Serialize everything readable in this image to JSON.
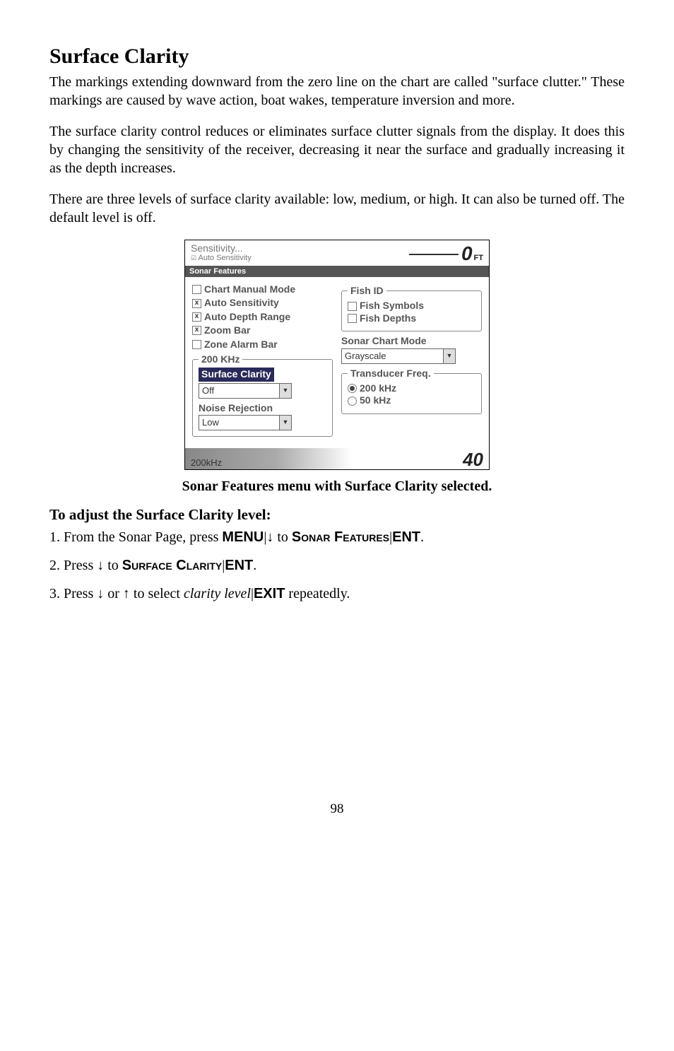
{
  "heading": "Surface Clarity",
  "para1": "The markings extending downward from the zero line on the chart are called \"surface clutter.\" These markings are caused by wave action, boat wakes, temperature inversion and more.",
  "para2": "The surface clarity control reduces or eliminates surface clutter signals from the display. It does this by changing the sensitivity of the receiver, decreasing it near the surface and gradually increasing it as the depth increases.",
  "para3": "There are three levels of surface clarity available: low, medium, or high. It can also be turned off. The default level is off.",
  "figure": {
    "top": {
      "sensitivity_label": "Sensitivity...",
      "auto_sens_partial": "Auto Sensitivity",
      "depth_value": "0",
      "depth_unit": "FT"
    },
    "tab_title": "Sonar Features",
    "left_col": {
      "chart_manual_mode": {
        "label": "Chart Manual Mode",
        "checked": false
      },
      "auto_sensitivity": {
        "label": "Auto Sensitivity",
        "checked": true
      },
      "auto_depth_range": {
        "label": "Auto Depth Range",
        "checked": true
      },
      "zoom_bar": {
        "label": "Zoom Bar",
        "checked": true
      },
      "zone_alarm_bar": {
        "label": "Zone Alarm Bar",
        "checked": false
      },
      "freq_group_label": "200 KHz",
      "surface_clarity_label": "Surface Clarity",
      "surface_clarity_value": "Off",
      "noise_rejection_label": "Noise Rejection",
      "noise_rejection_value": "Low"
    },
    "right_col": {
      "fish_id_label": "Fish ID",
      "fish_symbols": {
        "label": "Fish Symbols",
        "checked": false
      },
      "fish_depths": {
        "label": "Fish Depths",
        "checked": false
      },
      "sonar_chart_mode_label": "Sonar Chart Mode",
      "sonar_chart_mode_value": "Grayscale",
      "transducer_freq_label": "Transducer Freq.",
      "freq_200": {
        "label": "200 kHz",
        "selected": true
      },
      "freq_50": {
        "label": "50 kHz",
        "selected": false
      }
    },
    "bottom": {
      "khz_label": "200kHz",
      "depth_value": "40"
    }
  },
  "caption": "Sonar Features menu with Surface Clarity selected.",
  "subhead": "To adjust the Surface Clarity level:",
  "step1": {
    "prefix": "1. From the Sonar Page, press ",
    "menu": "MENU",
    "to": " to ",
    "sonar_features": "Sonar Features",
    "ent": "ENT",
    "period": "."
  },
  "step2": {
    "prefix": "2. Press ",
    "to": " to ",
    "surface_clarity": "Surface Clarity",
    "ent": "ENT",
    "period": "."
  },
  "step3": {
    "prefix": "3. Press ",
    "or": " or ",
    "to_select": " to select ",
    "clarity_level": "clarity level",
    "exit": "EXIT",
    "suffix": " repeatedly."
  },
  "arrows": {
    "down": "↓",
    "up": "↑"
  },
  "pipe": "|",
  "page_number": "98"
}
